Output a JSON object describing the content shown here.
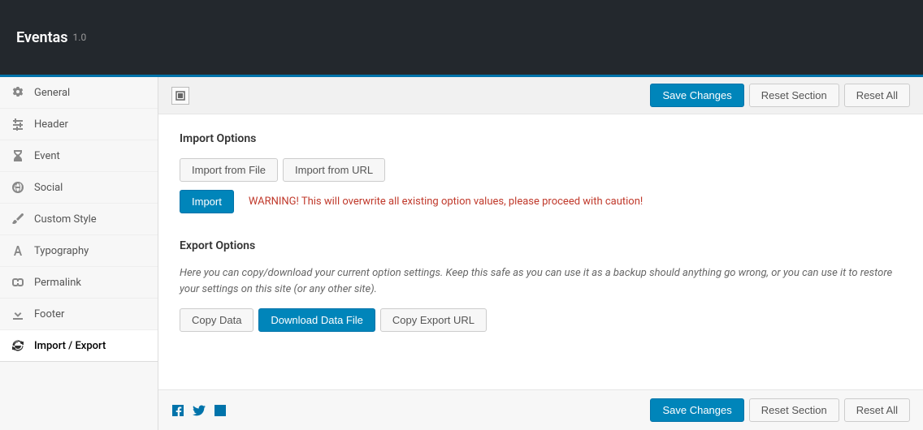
{
  "header": {
    "brand": "Eventas",
    "version": "1.0"
  },
  "sidebar": {
    "items": [
      {
        "icon": "gears",
        "label": "General"
      },
      {
        "icon": "sliders",
        "label": "Header"
      },
      {
        "icon": "hourglass",
        "label": "Event"
      },
      {
        "icon": "globe",
        "label": "Social"
      },
      {
        "icon": "brush",
        "label": "Custom Style"
      },
      {
        "icon": "font",
        "label": "Typography"
      },
      {
        "icon": "link",
        "label": "Permalink"
      },
      {
        "icon": "download",
        "label": "Footer"
      },
      {
        "icon": "refresh",
        "label": "Import / Export"
      }
    ],
    "active_index": 8
  },
  "toolbar": {
    "save_label": "Save Changes",
    "reset_section_label": "Reset Section",
    "reset_all_label": "Reset All"
  },
  "import": {
    "title": "Import Options",
    "btn_file": "Import from File",
    "btn_url": "Import from URL",
    "btn_import": "Import",
    "warning": "WARNING! This will overwrite all existing option values, please proceed with caution!"
  },
  "export": {
    "title": "Export Options",
    "description": "Here you can copy/download your current option settings. Keep this safe as you can use it as a backup should anything go wrong, or you can use it to restore your settings on this site (or any other site).",
    "btn_copy": "Copy Data",
    "btn_download": "Download Data File",
    "btn_copy_url": "Copy Export URL"
  },
  "colors": {
    "primary": "#0085ba",
    "warning": "#c0392b",
    "header_bg": "#23282d"
  }
}
